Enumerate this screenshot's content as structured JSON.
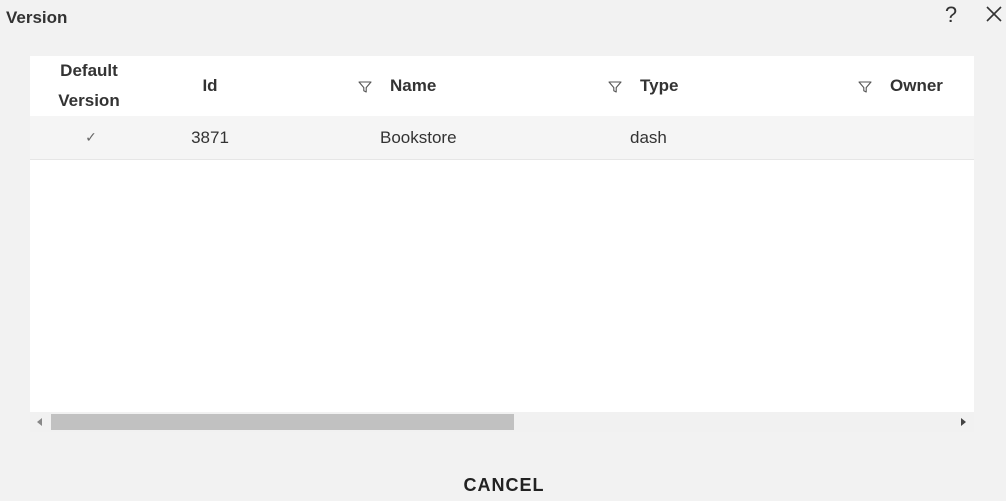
{
  "dialog": {
    "title": "Version",
    "help_label": "?"
  },
  "grid": {
    "columns": [
      {
        "line1": "Default",
        "line2": "Version"
      },
      {
        "label": "Id"
      },
      {
        "label": "Name"
      },
      {
        "label": "Type"
      },
      {
        "label": "Owner"
      }
    ],
    "rows": [
      {
        "default": "✓",
        "id": "3871",
        "name": "Bookstore",
        "type": "dash"
      }
    ],
    "scroll_fraction": 0.49
  },
  "footer": {
    "cancel_label": "CANCEL"
  },
  "icons": {
    "filter": "filter-icon",
    "close": "close-icon",
    "check": "checkmark-icon"
  }
}
